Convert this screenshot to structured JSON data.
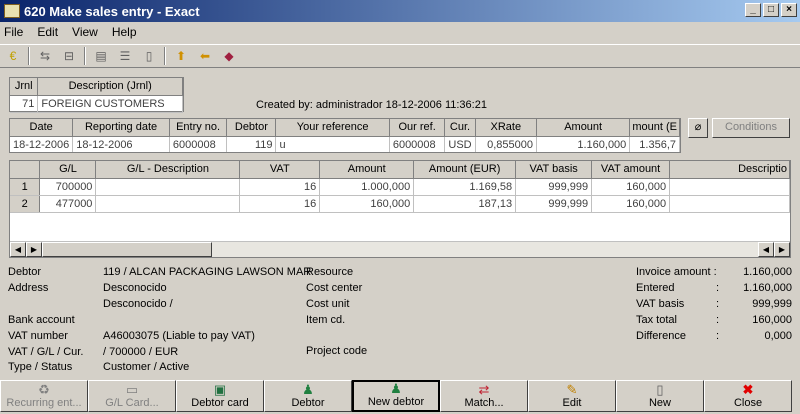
{
  "window": {
    "title": "620 Make sales entry - Exact"
  },
  "menu": [
    "File",
    "Edit",
    "View",
    "Help"
  ],
  "journal": {
    "headers": [
      "Jrnl",
      "Description (Jrnl)"
    ],
    "row": [
      "71",
      "FOREIGN CUSTOMERS"
    ]
  },
  "created_by": "Created by: administrador  18-12-2006 11:36:21",
  "entry": {
    "headers": [
      "Date",
      "Reporting date",
      "Entry no.",
      "Debtor",
      "Your reference",
      "Our ref.",
      "Cur.",
      "XRate",
      "Amount",
      "mount (E"
    ],
    "row": [
      "18-12-2006",
      "18-12-2006",
      "6000008",
      "119",
      "u",
      "6000008",
      "USD",
      "0,855000",
      "1.160,000",
      "1.356,7"
    ]
  },
  "conditions_label": "Conditions",
  "lines": {
    "headers": [
      "",
      "G/L",
      "G/L - Description",
      "VAT",
      "Amount",
      "Amount (EUR)",
      "VAT basis",
      "VAT amount",
      "Descriptio"
    ],
    "rows": [
      [
        "1",
        "700000",
        "",
        "16",
        "1.000,000",
        "1.169,58",
        "999,999",
        "160,000",
        ""
      ],
      [
        "2",
        "477000",
        "",
        "16",
        "160,000",
        "187,13",
        "999,999",
        "160,000",
        ""
      ]
    ]
  },
  "details": {
    "labels": [
      "Debtor",
      "Address",
      "",
      "Bank account",
      "VAT number",
      "VAT / G/L / Cur.",
      "Type / Status"
    ],
    "values": [
      "119 / ALCAN PACKAGING LAWSON MAR",
      "Desconocido",
      "Desconocido /",
      "",
      "A46003075 (Liable to pay VAT)",
      "/ 700000  / EUR",
      "Customer / Active"
    ],
    "mid_labels": [
      "Resource",
      "Cost center",
      "Cost unit",
      "Item cd.",
      "",
      "Project code"
    ]
  },
  "totals": [
    {
      "label": "Invoice amount :",
      "value": "1.160,000"
    },
    {
      "label": "Entered",
      "sep": ":",
      "value": "1.160,000"
    },
    {
      "label": "VAT basis",
      "sep": ":",
      "value": "999,999"
    },
    {
      "label": "Tax total",
      "sep": ":",
      "value": "160,000"
    },
    {
      "label": "Difference",
      "sep": ":",
      "value": "0,000"
    }
  ],
  "buttons": [
    "Recurring ent...",
    "G/L Card...",
    "Debtor card",
    "Debtor",
    "New debtor",
    "Match...",
    "Edit",
    "New",
    "Close"
  ]
}
